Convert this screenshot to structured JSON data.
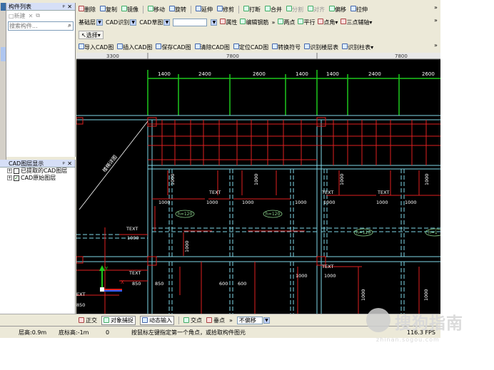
{
  "left_panel": {
    "component_list_title": "构件列表",
    "new_label": "新建",
    "search_placeholder": "搜索构件...",
    "cad_layers_title": "CAD图层显示",
    "layers": [
      {
        "label": "已提取的CAD图层",
        "checked": false
      },
      {
        "label": "CAD原始图层",
        "checked": true
      }
    ]
  },
  "toolbar1": [
    "删除",
    "复制",
    "镜像",
    "移动",
    "旋转",
    "延伸",
    "修剪",
    "打断",
    "合并",
    "分割",
    "对齐",
    "偏移",
    "拉伸"
  ],
  "toolbar2": {
    "layer_select": "基础层",
    "cad_identify": "CAD识别",
    "cad_sketch": "CAD草图",
    "items": [
      "属性",
      "编辑钢筋",
      "两点",
      "平行",
      "点角",
      "三点辅轴"
    ]
  },
  "toolbar3": {
    "select_label": "选择"
  },
  "toolbar4": [
    "导入CAD图",
    "插入CAD图",
    "保存CAD图",
    "清除CAD图",
    "定位CAD图",
    "转换符号",
    "识别楼层表",
    "识别柱表"
  ],
  "canvas": {
    "top_dims": [
      "3300",
      "7800",
      "7800"
    ],
    "second_dims": [
      "1400",
      "2400",
      "2600",
      "1400",
      "1400",
      "2400",
      "2600"
    ],
    "texts": [
      "TEXT",
      "TEXT",
      "TEXT",
      "TEXT",
      "TEXT",
      "TEXT",
      "EXT"
    ],
    "h_labels": [
      "h=120",
      "h=120",
      "h=120",
      "h=1"
    ],
    "numbers": [
      "1000",
      "1000",
      "1000",
      "1000",
      "1000",
      "1000",
      "1000",
      "1000",
      "1000",
      "1000",
      "1000",
      "1000",
      "1000",
      "1000",
      "850",
      "850",
      "600",
      "600",
      "850",
      "1000",
      "1000",
      "1000"
    ],
    "diagonal_text": "楼梯详图",
    "ucs_x": "X",
    "ucs_y": "Y"
  },
  "status_toolbar": [
    "正交",
    "对象捕捉",
    "动态输入",
    "交点",
    "垂点"
  ],
  "offset_select": "不偏移",
  "status_bar": {
    "floor_height": "层高:0.9m",
    "bottom_height": "底标高:-1m",
    "zero": "0",
    "hint": "按鼠标左键指定第一个角点，或拾取构件图元",
    "fps": "116.3 FPS"
  },
  "watermark": {
    "main": "搜狗指南",
    "sub": "zhinan.sogou.com"
  }
}
